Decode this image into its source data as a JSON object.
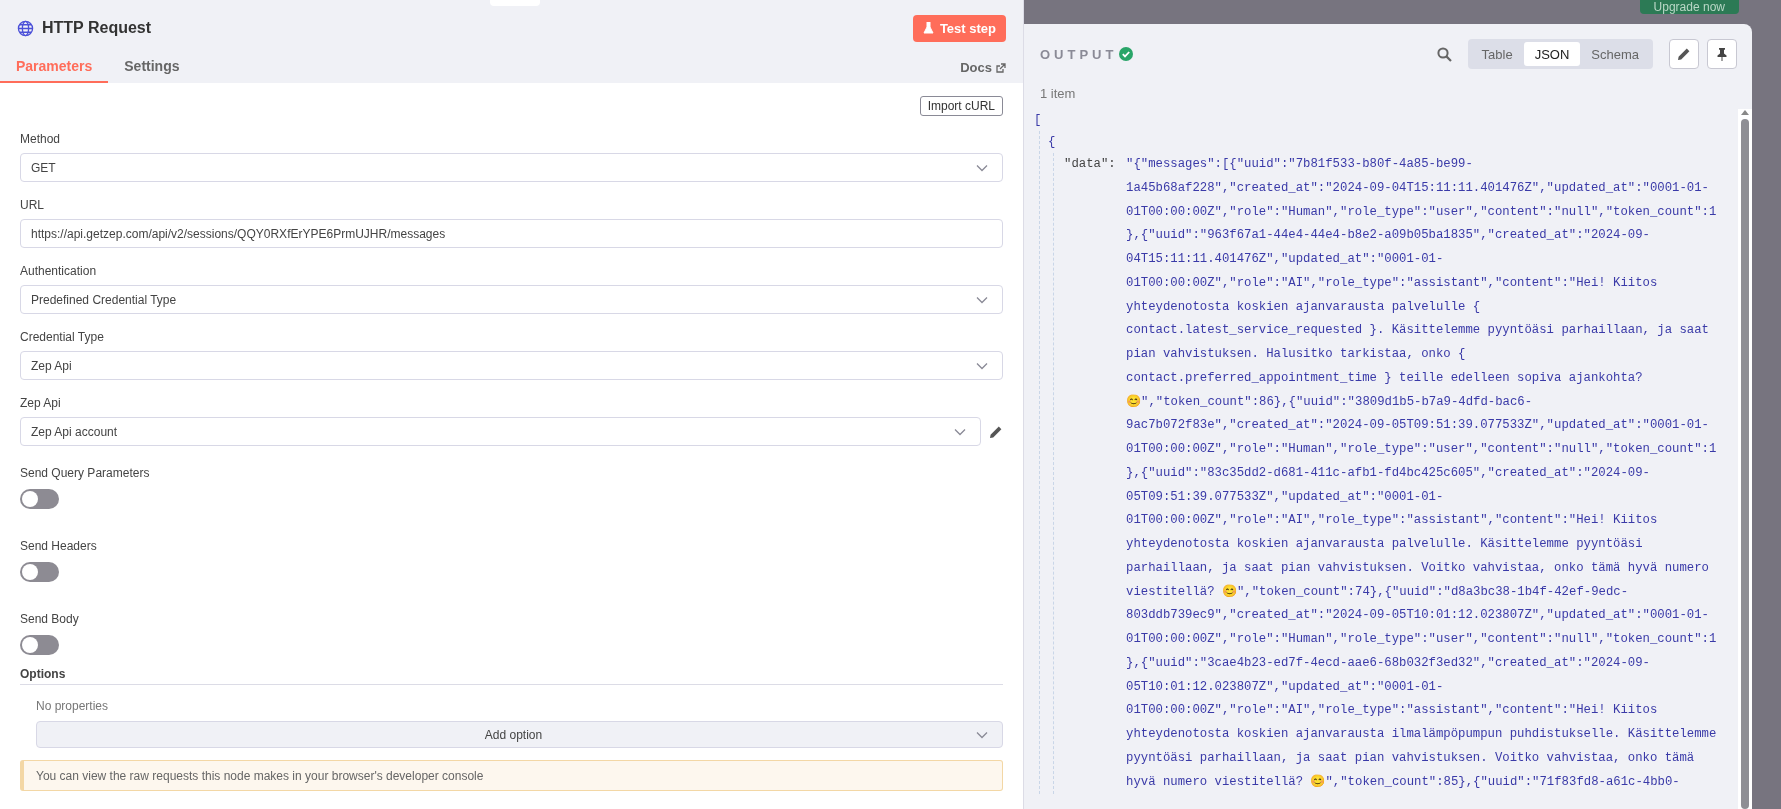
{
  "backdrop": {
    "upgrade_button": "Upgrade now"
  },
  "node": {
    "title": "HTTP Request",
    "test_button": "Test step",
    "tabs": [
      {
        "label": "Parameters",
        "selected": true
      },
      {
        "label": "Settings",
        "selected": false
      }
    ],
    "docs_link": "Docs",
    "import_button": "Import cURL",
    "fields": [
      {
        "kind": "select",
        "label": "Method",
        "value": "GET"
      },
      {
        "kind": "text",
        "label": "URL",
        "value": "https://api.getzep.com/api/v2/sessions/QQY0RXfErYPE6PrmUJHR/messages"
      },
      {
        "kind": "select",
        "label": "Authentication",
        "value": "Predefined Credential Type"
      },
      {
        "kind": "select",
        "label": "Credential Type",
        "value": "Zep Api"
      },
      {
        "kind": "credential",
        "label": "Zep Api",
        "value": "Zep Api account"
      },
      {
        "kind": "toggle",
        "label": "Send Query Parameters",
        "on": false
      },
      {
        "kind": "toggle",
        "label": "Send Headers",
        "on": false
      },
      {
        "kind": "toggle",
        "label": "Send Body",
        "on": false
      }
    ],
    "options": {
      "title": "Options",
      "empty_text": "No properties",
      "add_button": "Add option"
    },
    "notice": "You can view the raw requests this node makes in your browser's developer console"
  },
  "output": {
    "title": "OUTPUT",
    "success": true,
    "views": [
      {
        "label": "Table",
        "selected": false
      },
      {
        "label": "JSON",
        "selected": true
      },
      {
        "label": "Schema",
        "selected": false
      }
    ],
    "item_count": "1 item",
    "json": {
      "open_bracket": "[",
      "open_brace": "{",
      "key": "\"data\":",
      "value_lines": [
        "\"{\"messages\":[{\"uuid\":\"7b81f533-b80f-4a85-be99-",
        "1a45b68af228\",\"created_at\":\"2024-09-04T15:11:11.401476Z\",\"updated_at\":\"0001-01-",
        "01T00:00:00Z\",\"role\":\"Human\",\"role_type\":\"user\",\"content\":\"null\",\"token_count\":1",
        "},{\"uuid\":\"963f67a1-44e4-44e4-b8e2-a09b05ba1835\",\"created_at\":\"2024-09-",
        "04T15:11:11.401476Z\",\"updated_at\":\"0001-01-",
        "01T00:00:00Z\",\"role\":\"AI\",\"role_type\":\"assistant\",\"content\":\"Hei! Kiitos",
        "yhteydenotosta koskien ajanvarausta palvelulle {",
        "contact.latest_service_requested }. Käsittelemme pyyntöäsi parhaillaan, ja saat",
        "pian vahvistuksen. Halusitko tarkistaa, onko {",
        "contact.preferred_appointment_time } teille edelleen sopiva ajankohta?",
        "😊\",\"token_count\":86},{\"uuid\":\"3809d1b5-b7a9-4dfd-bac6-",
        "9ac7b072f83e\",\"created_at\":\"2024-09-05T09:51:39.077533Z\",\"updated_at\":\"0001-01-",
        "01T00:00:00Z\",\"role\":\"Human\",\"role_type\":\"user\",\"content\":\"null\",\"token_count\":1",
        "},{\"uuid\":\"83c35dd2-d681-411c-afb1-fd4bc425c605\",\"created_at\":\"2024-09-",
        "05T09:51:39.077533Z\",\"updated_at\":\"0001-01-",
        "01T00:00:00Z\",\"role\":\"AI\",\"role_type\":\"assistant\",\"content\":\"Hei! Kiitos",
        "yhteydenotosta koskien ajanvarausta palvelulle. Käsittelemme pyyntöäsi",
        "parhaillaan, ja saat pian vahvistuksen. Voitko vahvistaa, onko tämä hyvä numero",
        "viestitellä? 😊\",\"token_count\":74},{\"uuid\":\"d8a3bc38-1b4f-42ef-9edc-",
        "803ddb739ec9\",\"created_at\":\"2024-09-05T10:01:12.023807Z\",\"updated_at\":\"0001-01-",
        "01T00:00:00Z\",\"role\":\"Human\",\"role_type\":\"user\",\"content\":\"null\",\"token_count\":1",
        "},{\"uuid\":\"3cae4b23-ed7f-4ecd-aae6-68b032f3ed32\",\"created_at\":\"2024-09-",
        "05T10:01:12.023807Z\",\"updated_at\":\"0001-01-",
        "01T00:00:00Z\",\"role\":\"AI\",\"role_type\":\"assistant\",\"content\":\"Hei! Kiitos",
        "yhteydenotosta koskien ajanvarausta ilmalämpöpumpun puhdistukselle. Käsittelemme",
        "pyyntöäsi parhaillaan, ja saat pian vahvistuksen. Voitko vahvistaa, onko tämä",
        "hyvä numero viestitellä? 😊\",\"token_count\":85},{\"uuid\":\"71f83fd8-a61c-4bb0-"
      ]
    }
  }
}
